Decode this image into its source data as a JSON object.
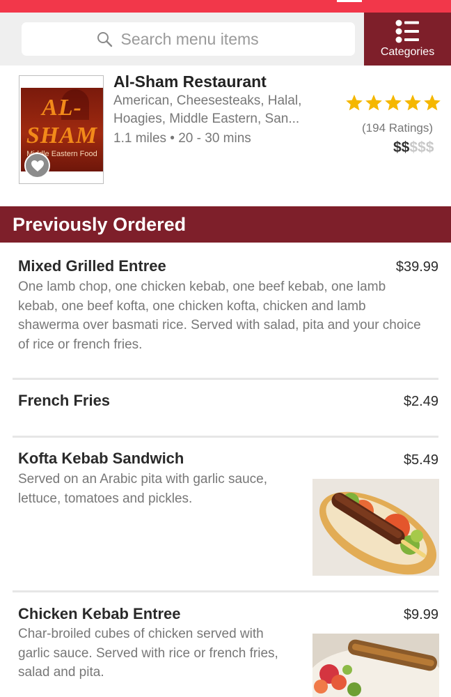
{
  "search": {
    "placeholder": "Search menu items"
  },
  "categories_button": {
    "label": "Categories"
  },
  "restaurant": {
    "name": "Al-Sham Restaurant",
    "cuisines": "American, Cheesesteaks, Halal, Hoagies, Middle Eastern, San...",
    "distance_and_time": "1.1 miles • 20 - 30 mins",
    "rating_stars": 5,
    "ratings_count": "(194 Ratings)",
    "price_active": "$$",
    "price_inactive": "$$$",
    "logo": {
      "line1": "AL-",
      "line2": "SHAM",
      "tagline": "Middle Eastern Food"
    }
  },
  "section": {
    "title": "Previously Ordered"
  },
  "menu_items": [
    {
      "name": "Mixed Grilled Entree",
      "price": "$39.99",
      "description": "One lamb chop, one chicken kebab, one beef kebab, one lamb kebab, one beef kofta, one chicken kofta, chicken and lamb shawerma over basmati rice. Served with salad, pita and your choice of rice or french fries."
    },
    {
      "name": "French Fries",
      "price": "$2.49"
    },
    {
      "name": "Kofta Kebab Sandwich",
      "price": "$5.49",
      "description": "Served on an Arabic pita with garlic sauce, lettuce, tomatoes and pickles."
    },
    {
      "name": "Chicken Kebab Entree",
      "price": "$9.99",
      "description": "Char-broiled cubes of chicken served with garlic sauce. Served with rice or french fries, salad and pita."
    }
  ],
  "colors": {
    "top_bar": "#f2374a",
    "brand_dark": "#7e1f2a",
    "star": "#f5b700"
  },
  "icons": [
    "search-icon",
    "list-icon",
    "heart-icon",
    "star-icon"
  ]
}
